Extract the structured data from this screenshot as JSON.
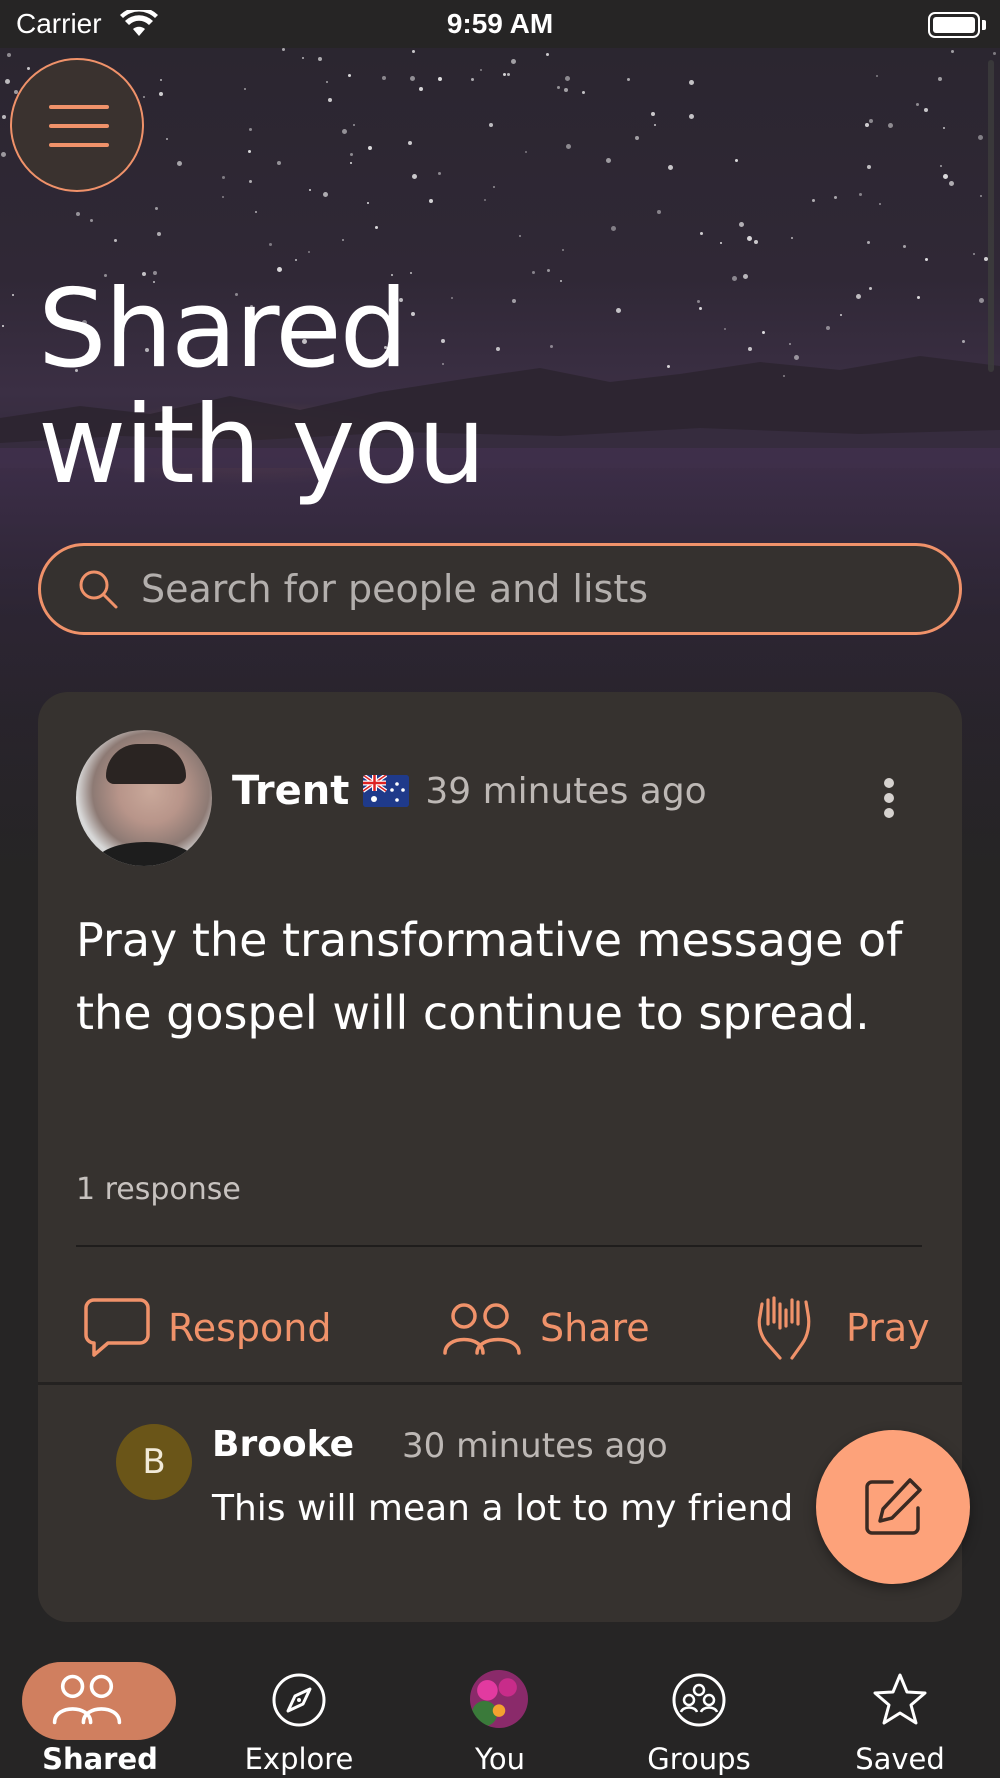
{
  "status_bar": {
    "carrier": "Carrier",
    "time": "9:59 AM"
  },
  "header": {
    "menu_icon": "hamburger-menu-icon",
    "title_line1": "Shared",
    "title_line2": "with you"
  },
  "search": {
    "placeholder": "Search for people and lists",
    "value": "",
    "icon": "search-icon"
  },
  "post": {
    "author": "Trent",
    "flag": "australia-flag-icon",
    "time": "39 minutes ago",
    "text": "Pray the transformative message of the gospel will continue to spread.",
    "response_count": "1 response",
    "actions": {
      "respond": "Respond",
      "share": "Share",
      "pray": "Pray"
    },
    "reply": {
      "initial": "B",
      "author": "Brooke",
      "time": "30 minutes ago",
      "text": "This will mean a lot to my friend"
    }
  },
  "tabs": [
    {
      "label": "Shared",
      "icon": "people-icon",
      "active": true
    },
    {
      "label": "Explore",
      "icon": "compass-icon",
      "active": false
    },
    {
      "label": "You",
      "icon": "user-avatar",
      "active": false
    },
    {
      "label": "Groups",
      "icon": "groups-icon",
      "active": false
    },
    {
      "label": "Saved",
      "icon": "star-icon",
      "active": false
    }
  ],
  "colors": {
    "accent": "#f0926a",
    "compose_button": "#fda27a",
    "active_tab": "#d07f5f",
    "card": "#36322f",
    "background": "#262525"
  }
}
